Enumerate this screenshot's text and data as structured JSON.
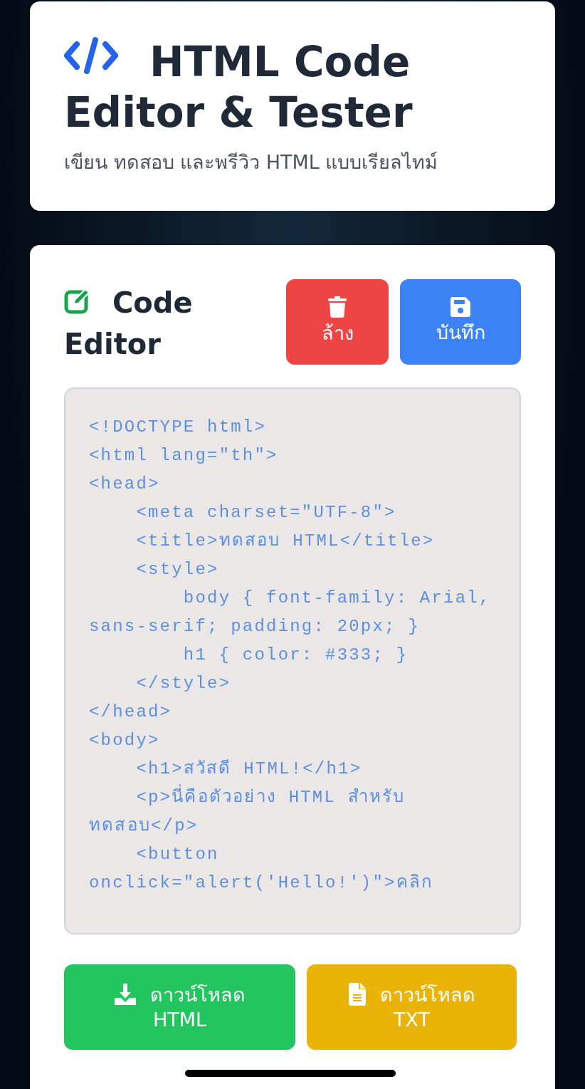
{
  "header": {
    "title": "HTML Code Editor & Tester",
    "subtitle": "เขียน ทดสอบ และพรีวิว HTML แบบเรียลไทม์"
  },
  "editor": {
    "title": "Code Editor",
    "actions": [
      {
        "kind": "clear",
        "label": "ล้าง"
      },
      {
        "kind": "save",
        "label": "บันทึก"
      }
    ],
    "code": "<!DOCTYPE html>\n<html lang=\"th\">\n<head>\n    <meta charset=\"UTF-8\">\n    <title>ทดสอบ HTML</title>\n    <style>\n        body { font-family: Arial, sans-serif; padding: 20px; }\n        h1 { color: #333; }\n    </style>\n</head>\n<body>\n    <h1>สวัสดี HTML!</h1>\n    <p>นี่คือตัวอย่าง HTML สำหรับทดสอบ</p>\n    <button onclick=\"alert('Hello!')\">คลิก",
    "downloads": [
      {
        "kind": "html",
        "label": "ดาวน์โหลด",
        "format": "HTML"
      },
      {
        "kind": "txt",
        "label": "ดาวน์โหลด",
        "format": "TXT"
      }
    ]
  }
}
